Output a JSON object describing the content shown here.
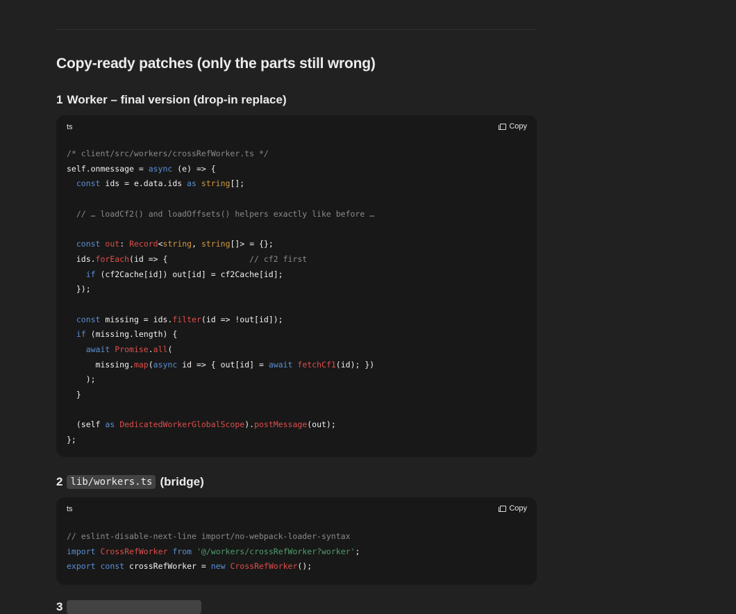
{
  "heading": "Copy-ready patches (only the parts still wrong)",
  "sections": [
    {
      "number": "1",
      "title": "Worker – final version (drop-in replace)",
      "lang": "ts",
      "copy_label": "Copy",
      "code": [
        [
          [
            "c",
            "/* client/src/workers/crossRefWorker.ts */"
          ]
        ],
        [
          [
            "p",
            "self.onmessage = "
          ],
          [
            "k",
            "async"
          ],
          [
            "p",
            " (e) => {"
          ]
        ],
        [
          [
            "p",
            "  "
          ],
          [
            "k",
            "const"
          ],
          [
            "p",
            " ids = e.data.ids "
          ],
          [
            "k",
            "as"
          ],
          [
            "p",
            " "
          ],
          [
            "t",
            "string"
          ],
          [
            "p",
            "[];"
          ]
        ],
        [],
        [
          [
            "p",
            "  "
          ],
          [
            "c",
            "// … loadCf2() and loadOffsets() helpers exactly like before …"
          ]
        ],
        [],
        [
          [
            "p",
            "  "
          ],
          [
            "k",
            "const"
          ],
          [
            "p",
            " "
          ],
          [
            "f",
            "out"
          ],
          [
            "p",
            ": "
          ],
          [
            "f",
            "Record"
          ],
          [
            "p",
            "<"
          ],
          [
            "t",
            "string"
          ],
          [
            "p",
            ", "
          ],
          [
            "t",
            "string"
          ],
          [
            "p",
            "[]> = {};"
          ]
        ],
        [
          [
            "p",
            "  ids."
          ],
          [
            "f",
            "forEach"
          ],
          [
            "p",
            "(id => {                 "
          ],
          [
            "c",
            "// cf2 first"
          ]
        ],
        [
          [
            "p",
            "    "
          ],
          [
            "k",
            "if"
          ],
          [
            "p",
            " (cf2Cache[id]) out[id] = cf2Cache[id];"
          ]
        ],
        [
          [
            "p",
            "  });"
          ]
        ],
        [],
        [
          [
            "p",
            "  "
          ],
          [
            "k",
            "const"
          ],
          [
            "p",
            " missing = ids."
          ],
          [
            "f",
            "filter"
          ],
          [
            "p",
            "(id => !out[id]);"
          ]
        ],
        [
          [
            "p",
            "  "
          ],
          [
            "k",
            "if"
          ],
          [
            "p",
            " (missing.length) {"
          ]
        ],
        [
          [
            "p",
            "    "
          ],
          [
            "k",
            "await"
          ],
          [
            "p",
            " "
          ],
          [
            "f",
            "Promise"
          ],
          [
            "p",
            "."
          ],
          [
            "f",
            "all"
          ],
          [
            "p",
            "("
          ]
        ],
        [
          [
            "p",
            "      missing."
          ],
          [
            "f",
            "map"
          ],
          [
            "p",
            "("
          ],
          [
            "k",
            "async"
          ],
          [
            "p",
            " id => { out[id] = "
          ],
          [
            "k",
            "await"
          ],
          [
            "p",
            " "
          ],
          [
            "f",
            "fetchCf1"
          ],
          [
            "p",
            "(id); })"
          ]
        ],
        [
          [
            "p",
            "    );"
          ]
        ],
        [
          [
            "p",
            "  }"
          ]
        ],
        [],
        [
          [
            "p",
            "  (self "
          ],
          [
            "k",
            "as"
          ],
          [
            "p",
            " "
          ],
          [
            "f",
            "DedicatedWorkerGlobalScope"
          ],
          [
            "p",
            ")."
          ],
          [
            "f",
            "postMessage"
          ],
          [
            "p",
            "(out);"
          ]
        ],
        [
          [
            "p",
            "};"
          ]
        ]
      ]
    },
    {
      "number": "2",
      "code_chip": "lib/workers.ts",
      "title": "(bridge)",
      "lang": "ts",
      "copy_label": "Copy",
      "code": [
        [
          [
            "c",
            "// eslint-disable-next-line import/no-webpack-loader-syntax"
          ]
        ],
        [
          [
            "k",
            "import"
          ],
          [
            "p",
            " "
          ],
          [
            "f",
            "CrossRefWorker"
          ],
          [
            "p",
            " "
          ],
          [
            "k",
            "from"
          ],
          [
            "p",
            " "
          ],
          [
            "s",
            "'@/workers/crossRefWorker?worker'"
          ],
          [
            "p",
            ";"
          ]
        ],
        [
          [
            "k",
            "export"
          ],
          [
            "p",
            " "
          ],
          [
            "k",
            "const"
          ],
          [
            "p",
            " crossRefWorker = "
          ],
          [
            "k",
            "new"
          ],
          [
            "p",
            " "
          ],
          [
            "f",
            "CrossRefWorker"
          ],
          [
            "p",
            "();"
          ]
        ]
      ]
    },
    {
      "number": "3"
    }
  ]
}
